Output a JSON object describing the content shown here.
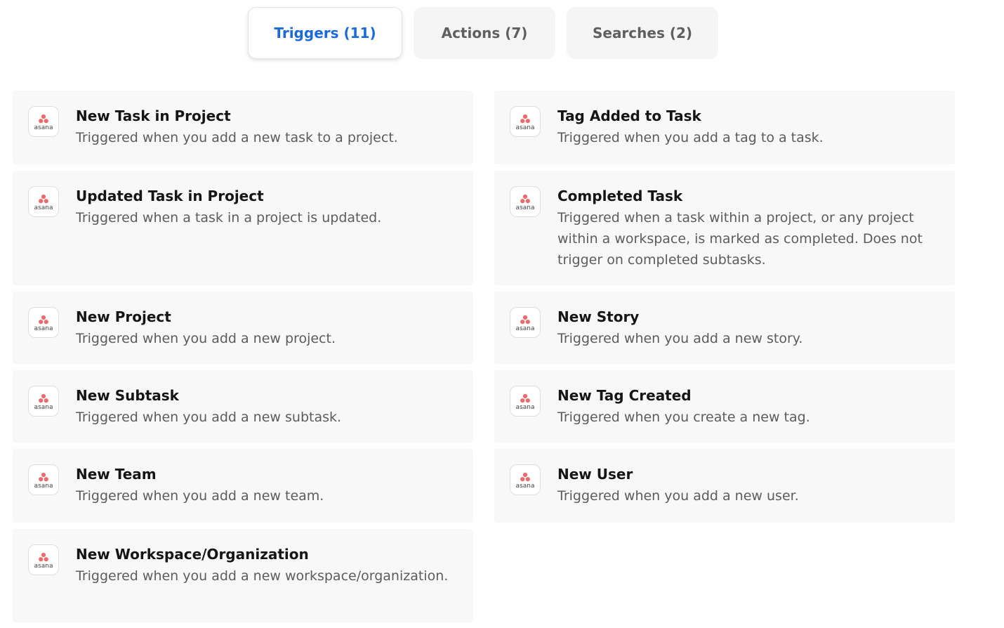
{
  "tabs": [
    {
      "label": "Triggers (11)",
      "active": true
    },
    {
      "label": "Actions (7)",
      "active": false
    },
    {
      "label": "Searches (2)",
      "active": false
    }
  ],
  "app_logo": {
    "icon": "asana-logo-icon",
    "wordmark": "asana",
    "color": "#f06a6a"
  },
  "triggers": [
    {
      "title": "New Task in Project",
      "description": "Triggered when you add a new task to a project."
    },
    {
      "title": "Tag Added to Task",
      "description": "Triggered when you add a tag to a task."
    },
    {
      "title": "Updated Task in Project",
      "description": "Triggered when a task in a project is updated."
    },
    {
      "title": "Completed Task",
      "description": "Triggered when a task within a project, or any project within a workspace, is marked as completed. Does not trigger on completed subtasks."
    },
    {
      "title": "New Project",
      "description": "Triggered when you add a new project."
    },
    {
      "title": "New Story",
      "description": "Triggered when you add a new story."
    },
    {
      "title": "New Subtask",
      "description": "Triggered when you add a new subtask."
    },
    {
      "title": "New Tag Created",
      "description": "Triggered when you create a new tag."
    },
    {
      "title": "New Team",
      "description": "Triggered when you add a new team."
    },
    {
      "title": "New User",
      "description": "Triggered when you add a new user."
    },
    {
      "title": "New Workspace/Organization",
      "description": "Triggered when you add a new workspace/organization."
    }
  ]
}
